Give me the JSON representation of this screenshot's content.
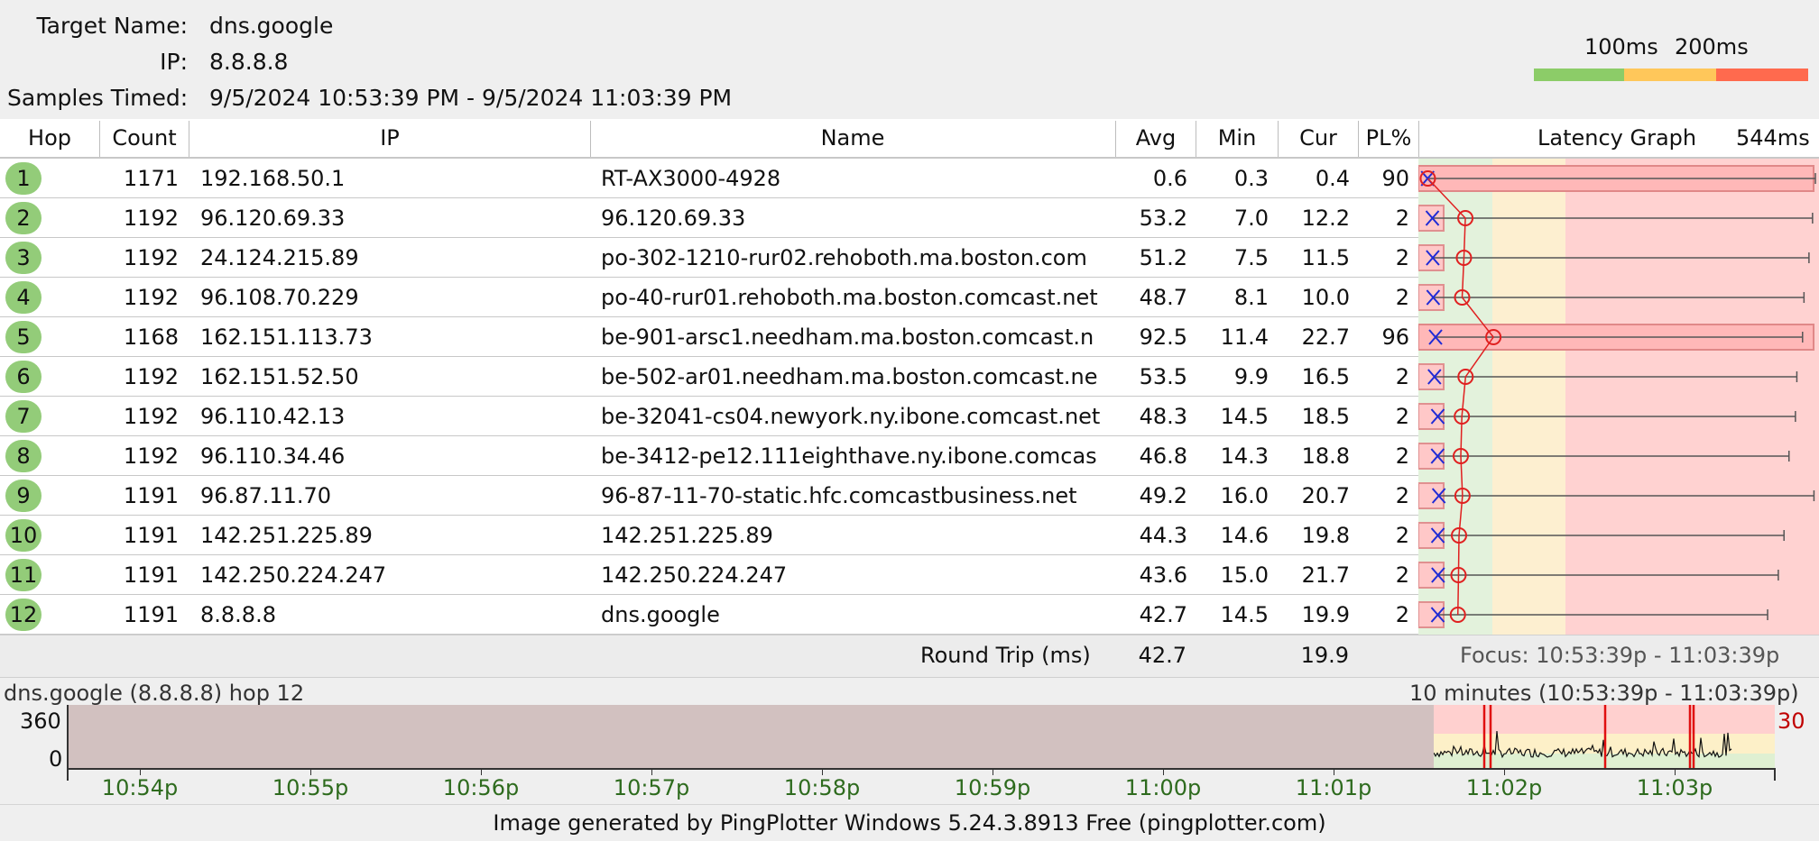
{
  "summary": {
    "target_label": "Target Name:",
    "target_value": "dns.google",
    "ip_label": "IP:",
    "ip_value": "8.8.8.8",
    "samples_label": "Samples Timed:",
    "samples_value": "9/5/2024 10:53:39 PM - 9/5/2024 11:03:39 PM"
  },
  "legend": {
    "scale_100": "100ms",
    "scale_200": "200ms",
    "colors": {
      "good": "#8ccc68",
      "warn": "#ffc75a",
      "bad": "#ff6a4e"
    }
  },
  "table": {
    "headers": {
      "hop": "Hop",
      "count": "Count",
      "ip": "IP",
      "name": "Name",
      "avg": "Avg",
      "min": "Min",
      "cur": "Cur",
      "pl": "PL%",
      "graph": "Latency Graph",
      "graph_max": "544ms"
    },
    "rows": [
      {
        "hop": "1",
        "count": "1171",
        "ip": "192.168.50.1",
        "name": "RT-AX3000-4928",
        "avg": "0.6",
        "min": "0.3",
        "cur": "0.4",
        "pl": "90",
        "max_ms": 544
      },
      {
        "hop": "2",
        "count": "1192",
        "ip": "96.120.69.33",
        "name": "96.120.69.33",
        "avg": "53.2",
        "min": "7.0",
        "cur": "12.2",
        "pl": "2",
        "max_ms": 540
      },
      {
        "hop": "3",
        "count": "1192",
        "ip": "24.124.215.89",
        "name": "po-302-1210-rur02.rehoboth.ma.boston.com",
        "avg": "51.2",
        "min": "7.5",
        "cur": "11.5",
        "pl": "2",
        "max_ms": 535
      },
      {
        "hop": "4",
        "count": "1192",
        "ip": "96.108.70.229",
        "name": "po-40-rur01.rehoboth.ma.boston.comcast.net",
        "avg": "48.7",
        "min": "8.1",
        "cur": "10.0",
        "pl": "2",
        "max_ms": 528
      },
      {
        "hop": "5",
        "count": "1168",
        "ip": "162.151.113.73",
        "name": "be-901-arsc1.needham.ma.boston.comcast.n",
        "avg": "92.5",
        "min": "11.4",
        "cur": "22.7",
        "pl": "96",
        "max_ms": 526
      },
      {
        "hop": "6",
        "count": "1192",
        "ip": "162.151.52.50",
        "name": "be-502-ar01.needham.ma.boston.comcast.ne",
        "avg": "53.5",
        "min": "9.9",
        "cur": "16.5",
        "pl": "2",
        "max_ms": 518
      },
      {
        "hop": "7",
        "count": "1192",
        "ip": "96.110.42.13",
        "name": "be-32041-cs04.newyork.ny.ibone.comcast.net",
        "avg": "48.3",
        "min": "14.5",
        "cur": "18.5",
        "pl": "2",
        "max_ms": 516
      },
      {
        "hop": "8",
        "count": "1192",
        "ip": "96.110.34.46",
        "name": "be-3412-pe12.111eighthave.ny.ibone.comcas",
        "avg": "46.8",
        "min": "14.3",
        "cur": "18.8",
        "pl": "2",
        "max_ms": 507
      },
      {
        "hop": "9",
        "count": "1191",
        "ip": "96.87.11.70",
        "name": "96-87-11-70-static.hfc.comcastbusiness.net",
        "avg": "49.2",
        "min": "16.0",
        "cur": "20.7",
        "pl": "2",
        "max_ms": 542
      },
      {
        "hop": "10",
        "count": "1191",
        "ip": "142.251.225.89",
        "name": "142.251.225.89",
        "avg": "44.3",
        "min": "14.6",
        "cur": "19.8",
        "pl": "2",
        "max_ms": 500
      },
      {
        "hop": "11",
        "count": "1191",
        "ip": "142.250.224.247",
        "name": "142.250.224.247",
        "avg": "43.6",
        "min": "15.0",
        "cur": "21.7",
        "pl": "2",
        "max_ms": 492
      },
      {
        "hop": "12",
        "count": "1191",
        "ip": "8.8.8.8",
        "name": "dns.google",
        "avg": "42.7",
        "min": "14.5",
        "cur": "19.9",
        "pl": "2",
        "max_ms": 477
      }
    ]
  },
  "round_trip": {
    "label": "Round Trip (ms)",
    "avg": "42.7",
    "cur": "19.9",
    "focus": "Focus: 10:53:39p - 11:03:39p"
  },
  "timeline": {
    "target": "dns.google (8.8.8.8) hop 12",
    "range": "10 minutes (10:53:39p - 11:03:39p)",
    "y_top": "360",
    "y_bottom": "0",
    "pl_scale": "30",
    "ticks": [
      "10:54p",
      "10:55p",
      "10:56p",
      "10:57p",
      "10:58p",
      "10:59p",
      "11:00p",
      "11:01p",
      "11:02p",
      "11:03p"
    ]
  },
  "footer": {
    "text": "Image generated by PingPlotter Windows 5.24.3.8913 Free (pingplotter.com)"
  }
}
